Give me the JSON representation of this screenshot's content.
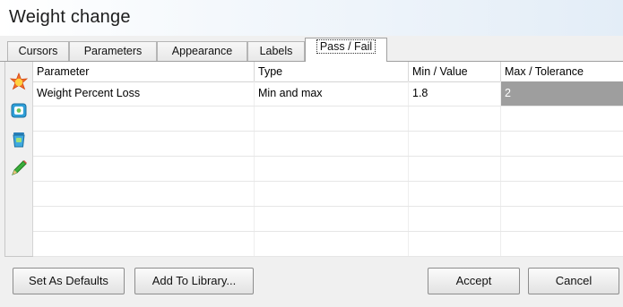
{
  "window": {
    "title": "Weight change"
  },
  "tabs": [
    {
      "label": "Cursors"
    },
    {
      "label": "Parameters"
    },
    {
      "label": "Appearance"
    },
    {
      "label": "Labels"
    },
    {
      "label": "Pass / Fail",
      "active": true
    }
  ],
  "toolbar_icons": [
    "add-star-icon",
    "edit-record-icon",
    "delete-bin-icon",
    "pencil-icon"
  ],
  "table": {
    "columns": [
      "Parameter",
      "Type",
      "Min / Value",
      "Max / Tolerance"
    ],
    "rows": [
      [
        "Weight Percent Loss",
        "Min and max",
        "1.8",
        "2"
      ]
    ],
    "empty_rows": 6,
    "selected_cell_color": "#9e9e9e"
  },
  "buttons": {
    "set_defaults": "Set As Defaults",
    "add_library": "Add To Library...",
    "accept": "Accept",
    "cancel": "Cancel"
  }
}
